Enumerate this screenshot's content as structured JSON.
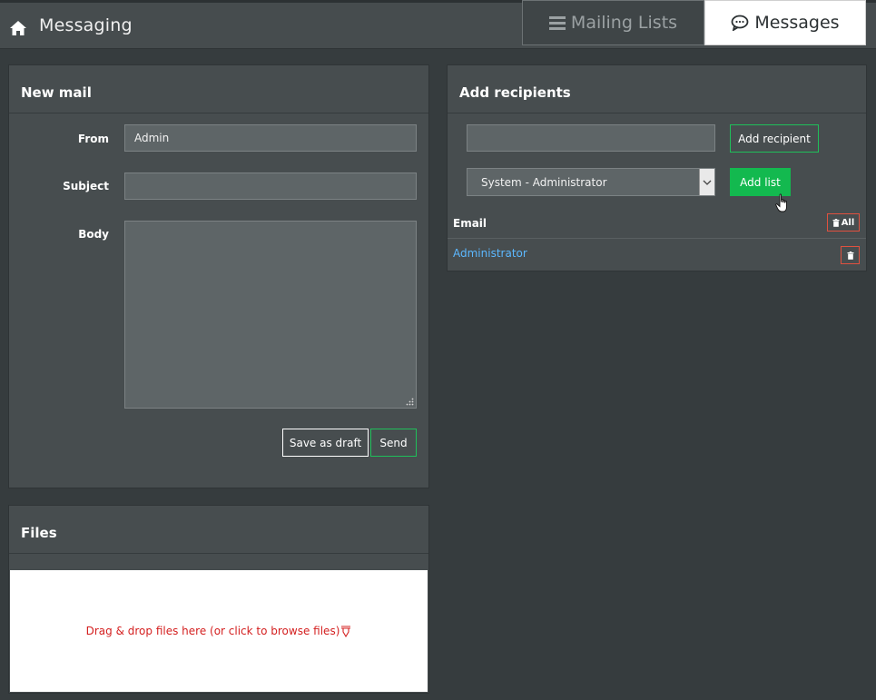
{
  "header": {
    "title": "Messaging",
    "tabs": [
      {
        "label": "Mailing Lists",
        "icon": "list-icon"
      },
      {
        "label": "Messages",
        "icon": "chat-bubble-icon"
      }
    ]
  },
  "new_mail": {
    "title": "New mail",
    "from_label": "From",
    "from_value": "Admin",
    "subject_label": "Subject",
    "subject_value": "",
    "body_label": "Body",
    "body_value": "",
    "save_draft_label": "Save as draft",
    "send_label": "Send"
  },
  "recipients": {
    "title": "Add recipients",
    "recipient_input_value": "",
    "add_recipient_label": "Add recipient",
    "list_selected": "System - Administrator",
    "add_list_label": "Add list",
    "column_email": "Email",
    "delete_all_label": "All",
    "rows": [
      {
        "email": "Administrator"
      }
    ]
  },
  "files": {
    "title": "Files",
    "dropzone_text": "Drag & drop files here (or click to browse files)"
  },
  "colors": {
    "accent_green": "#13b94f",
    "link_blue": "#5cb8ff",
    "danger_red": "#e0513f"
  }
}
